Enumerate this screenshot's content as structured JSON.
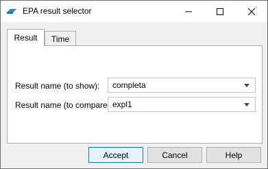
{
  "window": {
    "title": "EPA result selector"
  },
  "tabs": [
    {
      "label": "Result",
      "active": true
    },
    {
      "label": "Time",
      "active": false
    }
  ],
  "form": {
    "show": {
      "label": "Result name (to show):",
      "value": "completa"
    },
    "compare": {
      "label": "Result name (to compare):",
      "value": "expl1"
    }
  },
  "buttons": {
    "accept": "Accept",
    "cancel": "Cancel",
    "help": "Help"
  },
  "colors": {
    "accent": "#0078d7",
    "icon": "#1e88e5"
  }
}
